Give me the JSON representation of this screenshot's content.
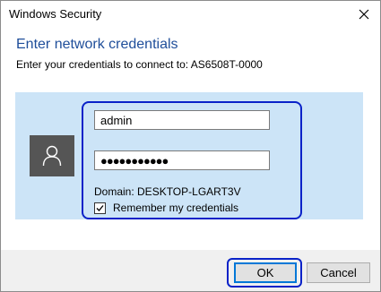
{
  "window": {
    "title": "Windows Security"
  },
  "dialog": {
    "heading": "Enter network credentials",
    "subheading": "Enter your credentials to connect to: AS6508T-0000"
  },
  "form": {
    "username_value": "admin",
    "password_value": "●●●●●●●●●●●",
    "domain_text": "Domain: DESKTOP-LGART3V",
    "remember_label": "Remember my credentials",
    "remember_checked": true
  },
  "buttons": {
    "ok_label": "OK",
    "cancel_label": "Cancel"
  },
  "icons": {
    "close": "close-icon",
    "user": "user-icon",
    "check": "checkmark-icon"
  },
  "colors": {
    "accent": "#1f4e9a",
    "panel": "#cce4f7",
    "focus_outline": "#0a22c8",
    "avatar_bg": "#555555"
  }
}
